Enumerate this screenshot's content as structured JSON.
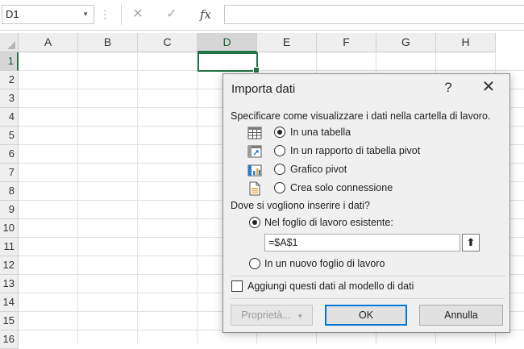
{
  "formula_bar": {
    "name_box": "D1",
    "cancel_glyph": "✕",
    "enter_glyph": "✓",
    "fx_label": "fx",
    "formula": ""
  },
  "grid": {
    "columns": [
      "A",
      "B",
      "C",
      "D",
      "E",
      "F",
      "G",
      "H"
    ],
    "selected_column": "D",
    "rows": [
      "1",
      "2",
      "3",
      "4",
      "5",
      "6",
      "7",
      "8",
      "9",
      "10",
      "11",
      "12",
      "13",
      "14",
      "15",
      "16"
    ],
    "selected_row": "1",
    "active_cell": "D1",
    "accent_color": "#217346"
  },
  "dialog": {
    "title": "Importa dati",
    "help": "?",
    "close": "✕",
    "view_prompt": "Specificare come visualizzare i dati nella cartella di lavoro.",
    "view_options": [
      {
        "label": "In una tabella",
        "icon": "table-icon",
        "selected": true
      },
      {
        "label": "In un rapporto di tabella pivot",
        "icon": "pivot-table-icon",
        "selected": false
      },
      {
        "label": "Grafico pivot",
        "icon": "pivot-chart-icon",
        "selected": false
      },
      {
        "label": "Crea solo connessione",
        "icon": "connection-only-icon",
        "selected": false
      }
    ],
    "dest_prompt": "Dove si vogliono inserire i dati?",
    "dest_existing_label": "Nel foglio di lavoro esistente:",
    "dest_existing_selected": true,
    "reference_value": "=$A$1",
    "collapse_glyph": "⬆",
    "dest_new_label": "In un nuovo foglio di lavoro",
    "data_model_label": "Aggiungi questi dati al modello di dati",
    "data_model_checked": false,
    "buttons": {
      "properties": "Proprietà...",
      "properties_arrow": "▾",
      "ok": "OK",
      "cancel": "Annulla"
    },
    "focus_color": "#0078d7"
  }
}
